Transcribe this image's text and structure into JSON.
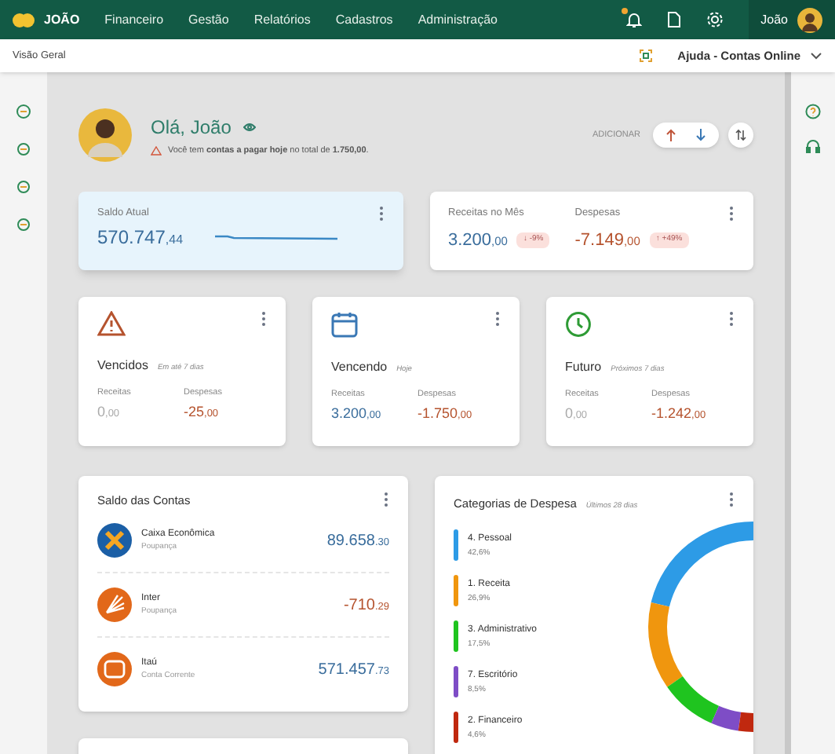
{
  "topbar": {
    "brand": "JOÃO",
    "menu": [
      "Financeiro",
      "Gestão",
      "Relatórios",
      "Cadastros",
      "Administração"
    ],
    "user": "João",
    "notification": true
  },
  "subbar": {
    "breadcrumb": "Visão Geral",
    "help": "Ajuda - Contas Online"
  },
  "greeting": {
    "title": "Olá, João",
    "alert": "Você tem **contas a pagar hoje** no total de **1.750,00**.",
    "add_label": "ADICIONAR"
  },
  "balance": {
    "label": "Saldo Atual",
    "value": "570.747",
    "cents": ",44"
  },
  "month": [
    {
      "label": "Receitas no Mês",
      "value": "3.200",
      "cents": ",00",
      "kind": "income",
      "badge": "↓ -9%"
    },
    {
      "label": "Despesas",
      "value": "-7.149",
      "cents": ",00",
      "kind": "expense",
      "badge": "↑ +49%"
    }
  ],
  "status_cards": [
    {
      "kind": "overdue",
      "title": "Vencidos",
      "subtitle": "Em até 7 dias",
      "income_label": "Receitas",
      "income": "0",
      "income_cents": ",00",
      "income_zero": true,
      "expense_label": "Despesas",
      "expense": "-25",
      "expense_cents": ",00"
    },
    {
      "kind": "today",
      "title": "Vencendo",
      "subtitle": "Hoje",
      "income_label": "Receitas",
      "income": "3.200",
      "income_cents": ",00",
      "income_zero": false,
      "expense_label": "Despesas",
      "expense": "-1.750",
      "expense_cents": ",00"
    },
    {
      "kind": "future",
      "title": "Futuro",
      "subtitle": "Próximos 7 dias",
      "income_label": "Receitas",
      "income": "0",
      "income_cents": ",00",
      "income_zero": true,
      "expense_label": "Despesas",
      "expense": "-1.242",
      "expense_cents": ",00"
    }
  ],
  "accounts": {
    "title": "Saldo das Contas",
    "items": [
      {
        "kind": "caixa",
        "name": "Caixa Econômica",
        "type": "Poupança",
        "value": "89.658",
        "cents": ".30",
        "negative": false
      },
      {
        "kind": "inter",
        "name": "Inter",
        "type": "Poupança",
        "value": "-710",
        "cents": ".29",
        "negative": true
      },
      {
        "kind": "itau",
        "name": "Itaú",
        "type": "Conta Corrente",
        "value": "571.457",
        "cents": ".73",
        "negative": false
      }
    ]
  },
  "categories": {
    "subtitle": "Últimos 28 dias",
    "items": [
      {
        "percent": "42,6%",
        "color": "#2d9be6"
      },
      {
        "percent": "26,9%",
        "color": "#f0960e"
      },
      {
        "percent": "17,5%",
        "color": "#1fc41f"
      },
      {
        "percent": "8,5%",
        "color": "#7e4dc6"
      },
      {
        "percent": "4,6%",
        "color": "#c0280f"
      }
    ],
    "chart_data": {
      "type": "donut",
      "categories": [
        "4. Pessoal",
        "1. Receita",
        "3. Administrativo",
        "7. Escritório",
        "2. Financeiro"
      ],
      "series": [
        {
          "name": "Categorias de Despesa",
          "values": [
            42.6,
            26.9,
            17.5,
            8.5,
            4.6
          ]
        }
      ]
    }
  }
}
